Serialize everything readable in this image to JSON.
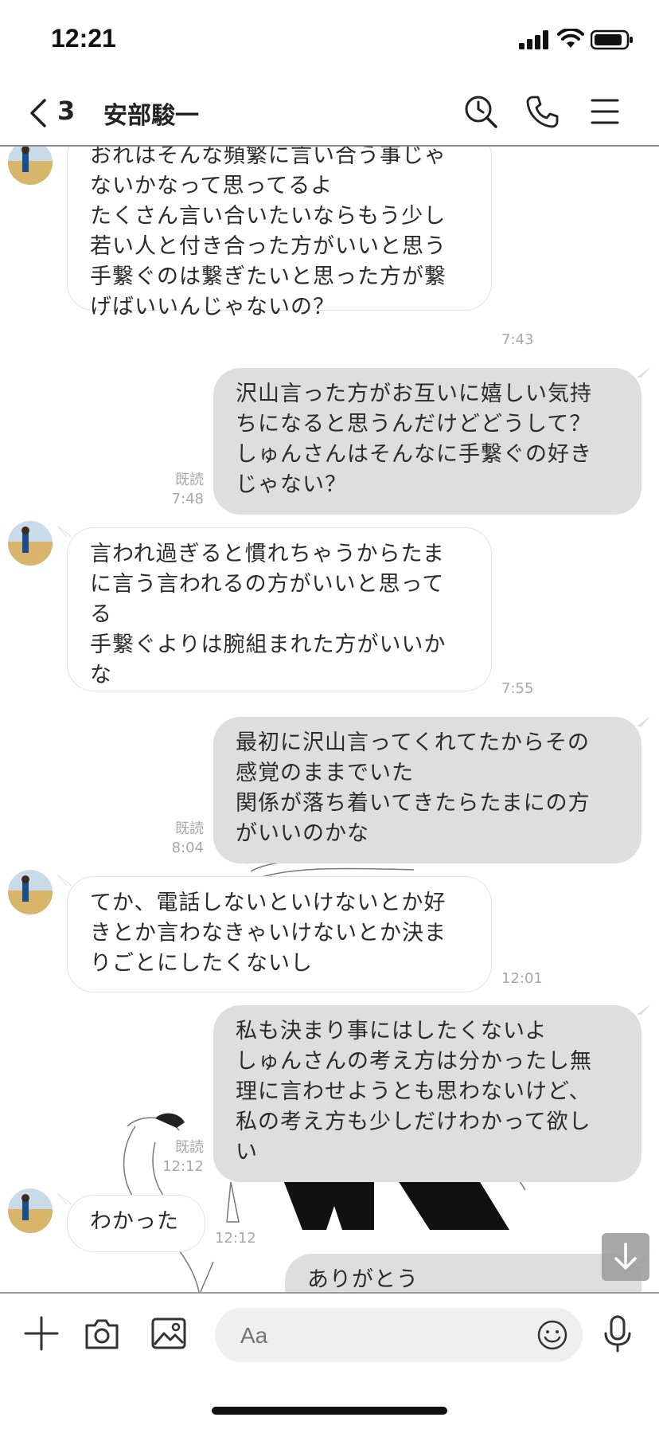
{
  "status_bar": {
    "time": "12:21"
  },
  "header": {
    "unread_count": "3",
    "contact_name": "安部駿一"
  },
  "messages": [
    {
      "dir": "in",
      "lines": [
        "おれはそんな頻繁に言い合う事じゃ",
        "ないかなって思ってるよ",
        "たくさん言い合いたいならもう少し",
        "若い人と付き合った方がいいと思う",
        "手繋ぐのは繋ぎたいと思った方が繋",
        "げばいいんじゃないの？"
      ],
      "time": "7:43"
    },
    {
      "dir": "out",
      "lines": [
        "沢山言った方がお互いに嬉しい気持",
        "ちになると思うんだけどどうして？",
        "しゅんさんはそんなに手繋ぐの好き",
        "じゃない？"
      ],
      "read": "既読",
      "time": "7:48"
    },
    {
      "dir": "in",
      "lines": [
        "言われ過ぎると慣れちゃうからたま",
        "に言う言われるの方がいいと思って",
        "る",
        "手繋ぐよりは腕組まれた方がいいか",
        "な"
      ],
      "time": "7:55"
    },
    {
      "dir": "out",
      "lines": [
        "最初に沢山言ってくれてたからその",
        "感覚のままでいた",
        "関係が落ち着いてきたらたまにの方",
        "がいいのかな"
      ],
      "read": "既読",
      "time": "8:04"
    },
    {
      "dir": "in",
      "lines": [
        "てか、電話しないといけないとか好",
        "きとか言わなきゃいけないとか決ま",
        "りごとにしたくないし"
      ],
      "time": "12:01"
    },
    {
      "dir": "out",
      "lines": [
        "私も決まり事にはしたくないよ",
        "しゅんさんの考え方は分かったし無",
        "理に言わせようとも思わないけど、",
        "私の考え方も少しだけわかって欲し",
        "い"
      ],
      "read": "既読",
      "time": "12:12"
    },
    {
      "dir": "in",
      "lines": [
        "わかった"
      ],
      "time": "12:12"
    },
    {
      "dir": "out",
      "lines": [
        "ありがとう"
      ]
    }
  ],
  "composer": {
    "placeholder": "Aa"
  },
  "icons": {
    "back": "chevron-left-icon",
    "search": "search-clock-icon",
    "call": "phone-icon",
    "menu": "hamburger-menu-icon",
    "plus": "plus-icon",
    "camera": "camera-icon",
    "image": "image-icon",
    "emoji": "emoji-icon",
    "mic": "microphone-icon",
    "scroll": "arrow-down-icon"
  },
  "colors": {
    "incoming_bubble": "#ffffff",
    "outgoing_bubble": "#dedede",
    "meta_text": "#a8a8a8"
  }
}
